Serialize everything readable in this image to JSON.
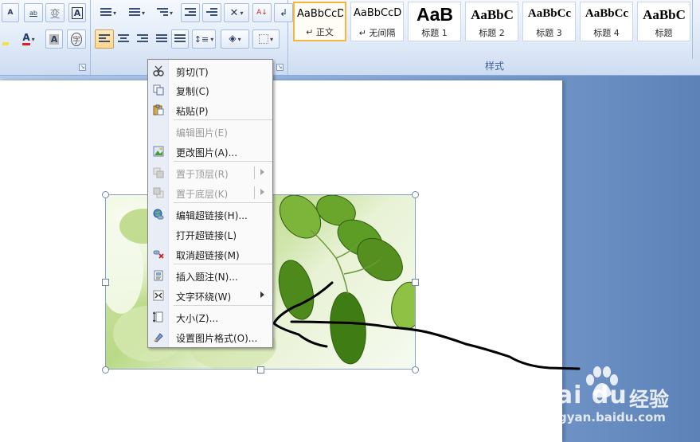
{
  "ribbon": {
    "font_group_launcher": "↘",
    "paragraph_group_launcher": "↘",
    "styles_group_label": "样式",
    "styles": [
      {
        "sample": "AaBbCcD",
        "name": "↵ 正文",
        "active": true
      },
      {
        "sample": "AaBbCcD",
        "name": "↵ 无间隔",
        "active": false
      },
      {
        "sample": "AaB",
        "name": "标题 1",
        "active": false
      },
      {
        "sample": "AaBbC",
        "name": "标题 2",
        "active": false
      },
      {
        "sample": "AaBbCc",
        "name": "标题 3",
        "active": false
      },
      {
        "sample": "AaBbCc",
        "name": "标题 4",
        "active": false
      },
      {
        "sample": "AaBbC",
        "name": "标题",
        "active": false
      }
    ],
    "font_buttons": {
      "superscript": "A",
      "format_painter": "ab",
      "phonetic": "变",
      "char_border": "A",
      "font_color": "A",
      "char_shading": "A",
      "enclose": "字"
    }
  },
  "context_menu": {
    "items": [
      {
        "label": "剪切(T)",
        "icon": "scissors-icon",
        "disabled": false
      },
      {
        "label": "复制(C)",
        "icon": "copy-icon",
        "disabled": false
      },
      {
        "label": "粘贴(P)",
        "icon": "paste-icon",
        "disabled": false
      },
      {
        "label": "编辑图片(E)",
        "icon": "",
        "disabled": true
      },
      {
        "label": "更改图片(A)...",
        "icon": "change-picture-icon",
        "disabled": false
      },
      {
        "label": "置于顶层(R)",
        "icon": "bring-front-icon",
        "disabled": true,
        "submenu": true
      },
      {
        "label": "置于底层(K)",
        "icon": "send-back-icon",
        "disabled": true,
        "submenu": true
      },
      {
        "label": "编辑超链接(H)...",
        "icon": "hyperlink-globe-icon",
        "disabled": false
      },
      {
        "label": "打开超链接(L)",
        "icon": "",
        "disabled": false
      },
      {
        "label": "取消超链接(M)",
        "icon": "remove-link-icon",
        "disabled": false
      },
      {
        "label": "插入题注(N)...",
        "icon": "caption-icon",
        "disabled": false
      },
      {
        "label": "文字环绕(W)",
        "icon": "text-wrap-icon",
        "disabled": false,
        "submenu": true
      },
      {
        "label": "大小(Z)...",
        "icon": "size-icon",
        "disabled": false
      },
      {
        "label": "设置图片格式(O)...",
        "icon": "format-picture-icon",
        "disabled": false
      }
    ]
  },
  "colors": {
    "accent_orange": "#f5b73a",
    "highlight_yellow": "#ffd68a",
    "font_color_red": "#e02020"
  },
  "watermark": {
    "brand": "Bai du",
    "sub": "经验",
    "url": "jingyan.baidu.com"
  }
}
